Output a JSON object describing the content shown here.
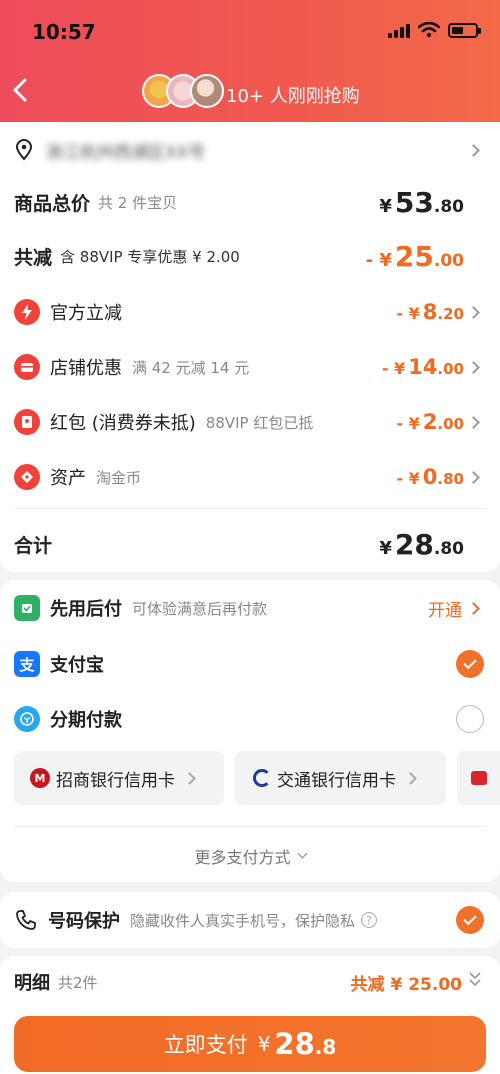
{
  "status_bar": {
    "time": "10:57"
  },
  "header": {
    "buyers_text": "10+ 人刚刚抢购"
  },
  "address": {
    "text": "浙江杭州西湖区XX号"
  },
  "summary": {
    "total_label": "商品总价",
    "total_count": "共 2 件宝贝",
    "total_price": {
      "currency": "¥",
      "integer": "53",
      "decimal": ".80"
    },
    "reduce_label": "共减",
    "reduce_note": "含 88VIP 专享优惠 ¥ 2.00",
    "reduce_price": {
      "prefix": "- ¥",
      "integer": "25",
      "decimal": ".00"
    },
    "items": [
      {
        "icon": "lightning-icon",
        "label": "官方立减",
        "sub": "",
        "prefix": "- ¥",
        "integer": "8",
        "decimal": ".20"
      },
      {
        "icon": "store-icon",
        "label": "店铺优惠",
        "sub": "满 42 元减 14 元",
        "prefix": "- ¥",
        "integer": "14",
        "decimal": ".00"
      },
      {
        "icon": "red-packet-icon",
        "label": "红包 (消费券未抵)",
        "sub": "88VIP 红包已抵",
        "prefix": "- ¥",
        "integer": "2",
        "decimal": ".00"
      },
      {
        "icon": "tag-icon",
        "label": "资产",
        "sub": "淘金币",
        "prefix": "- ¥",
        "integer": "0",
        "decimal": ".80"
      }
    ],
    "subtotal_label": "合计",
    "subtotal_price": {
      "currency": "¥",
      "integer": "28",
      "decimal": ".80"
    }
  },
  "payment": {
    "pay_later": {
      "label": "先用后付",
      "sub": "可体验满意后再付款",
      "action": "开通"
    },
    "alipay": {
      "label": "支付宝",
      "selected": true
    },
    "installment": {
      "label": "分期付款",
      "selected": false
    },
    "banks": [
      {
        "icon": "cmb-logo-icon",
        "label": "招商银行信用卡"
      },
      {
        "icon": "bocom-logo-icon",
        "label": "交通银行信用卡"
      }
    ],
    "more": "更多支付方式"
  },
  "privacy": {
    "label": "号码保护",
    "sub": "隐藏收件人真实手机号，保护隐私",
    "selected": true
  },
  "detail": {
    "label": "明细",
    "count": "共2件",
    "reduce": "共减 ¥ 25.00"
  },
  "pay_button": {
    "label": "立即支付",
    "currency": "¥",
    "integer": "28",
    "decimal": ".8"
  },
  "colors": {
    "accent": "#f06a1f",
    "header_start": "#ee4c5a",
    "header_end": "#f26a48",
    "icon_red": "#f0413a"
  }
}
